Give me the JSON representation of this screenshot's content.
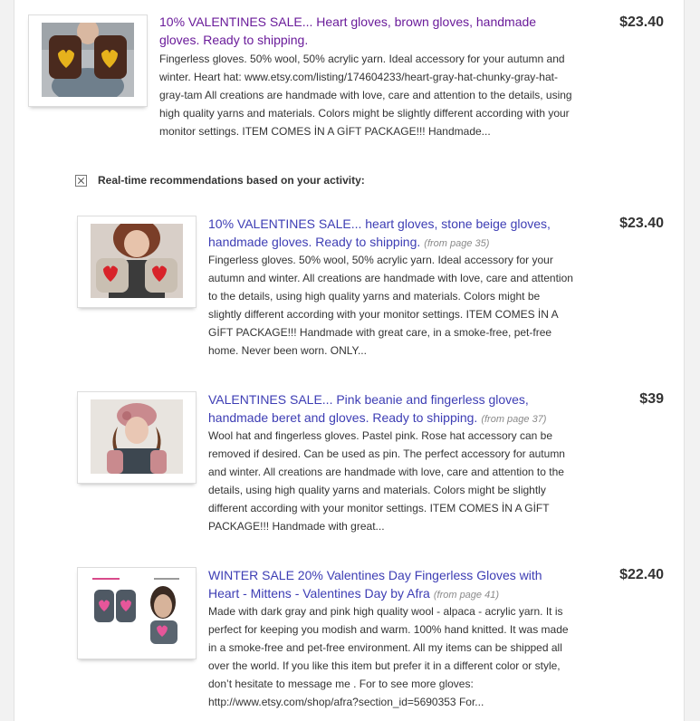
{
  "results": [
    {
      "title": "10% VALENTINES SALE... Heart gloves, brown gloves, handmade gloves. Ready to shipping.",
      "from_page": "",
      "description": "Fingerless gloves. 50% wool, 50% acrylic yarn. Ideal accessory for your autumn and winter. Heart hat: www.etsy.com/listing/174604233/heart-gray-hat-chunky-gray-hat-gray-tam All creations are handmade with love, care and attention to the details, using high quality yarns and materials. Colors might be slightly different according with your monitor settings. ITEM COMES İN A GİFT PACKAGE!!! Handmade...",
      "price": "$23.40"
    }
  ],
  "recommendations": {
    "heading": "Real-time recommendations based on your activity:",
    "items": [
      {
        "title": "10% VALENTINES SALE... heart gloves, stone beige gloves, handmade gloves. Ready to shipping.",
        "from_page": "(from page 35)",
        "description": "Fingerless gloves. 50% wool, 50% acrylic yarn. Ideal accessory for your autumn and winter. All creations are handmade with love, care and attention to the details, using high quality yarns and materials. Colors might be slightly different according with your monitor settings. ITEM COMES İN A GİFT PACKAGE!!! Handmade with great care, in a smoke-free, pet-free home. Never been worn. ONLY...",
        "price": "$23.40"
      },
      {
        "title": "VALENTINES SALE... Pink beanie and fingerless gloves, handmade beret and gloves. Ready to shipping.",
        "from_page": "(from page 37)",
        "description": "Wool hat and fingerless gloves. Pastel pink. Rose hat accessory can be removed if desired. Can be used as pin. The perfect accessory for autumn and winter. All creations are handmade with love, care and attention to the details, using high quality yarns and materials. Colors might be slightly different according with your monitor settings. ITEM COMES İN A GİFT PACKAGE!!! Handmade with great...",
        "price": "$39"
      },
      {
        "title": "WINTER SALE 20% Valentines Day Fingerless Gloves with Heart - Mittens - Valentines Day by Afra",
        "from_page": "(from page 41)",
        "description": "Made with dark gray and pink high quality wool - alpaca - acrylic yarn. It is perfect for keeping you modish and warm. 100% hand knitted. It was made in a smoke-free and pet-free environment. All my items can be shipped all over the world. If you like this item but prefer it in a different color or style, don’t hesitate to message me . For to see more gloves: http://www.etsy.com/shop/afra?section_id=5690353 For...",
        "price": "$22.40"
      }
    ]
  },
  "colors": {
    "visited_link": "#6a1b9a",
    "link": "#3d3db4",
    "text": "#333333"
  }
}
